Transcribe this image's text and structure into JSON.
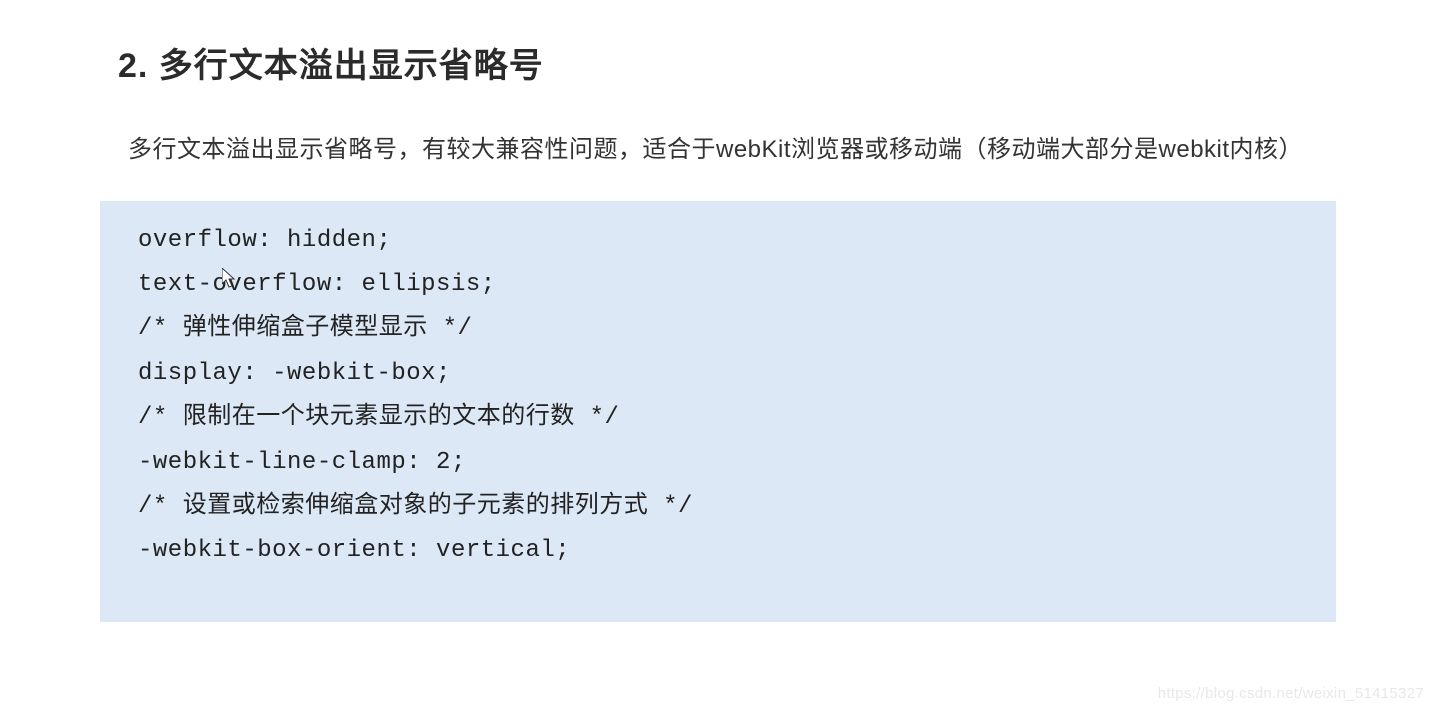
{
  "heading": "2. 多行文本溢出显示省略号",
  "description": "多行文本溢出显示省略号，有较大兼容性问题，适合于webKit浏览器或移动端（移动端大部分是webkit内核）",
  "code_lines": [
    "overflow: hidden;",
    "text-overflow: ellipsis;",
    "/* 弹性伸缩盒子模型显示 */",
    "display: -webkit-box;",
    "/* 限制在一个块元素显示的文本的行数 */",
    "-webkit-line-clamp: 2;",
    "/* 设置或检索伸缩盒对象的子元素的排列方式 */",
    "-webkit-box-orient: vertical;"
  ],
  "watermark": "https://blog.csdn.net/weixin_51415327"
}
